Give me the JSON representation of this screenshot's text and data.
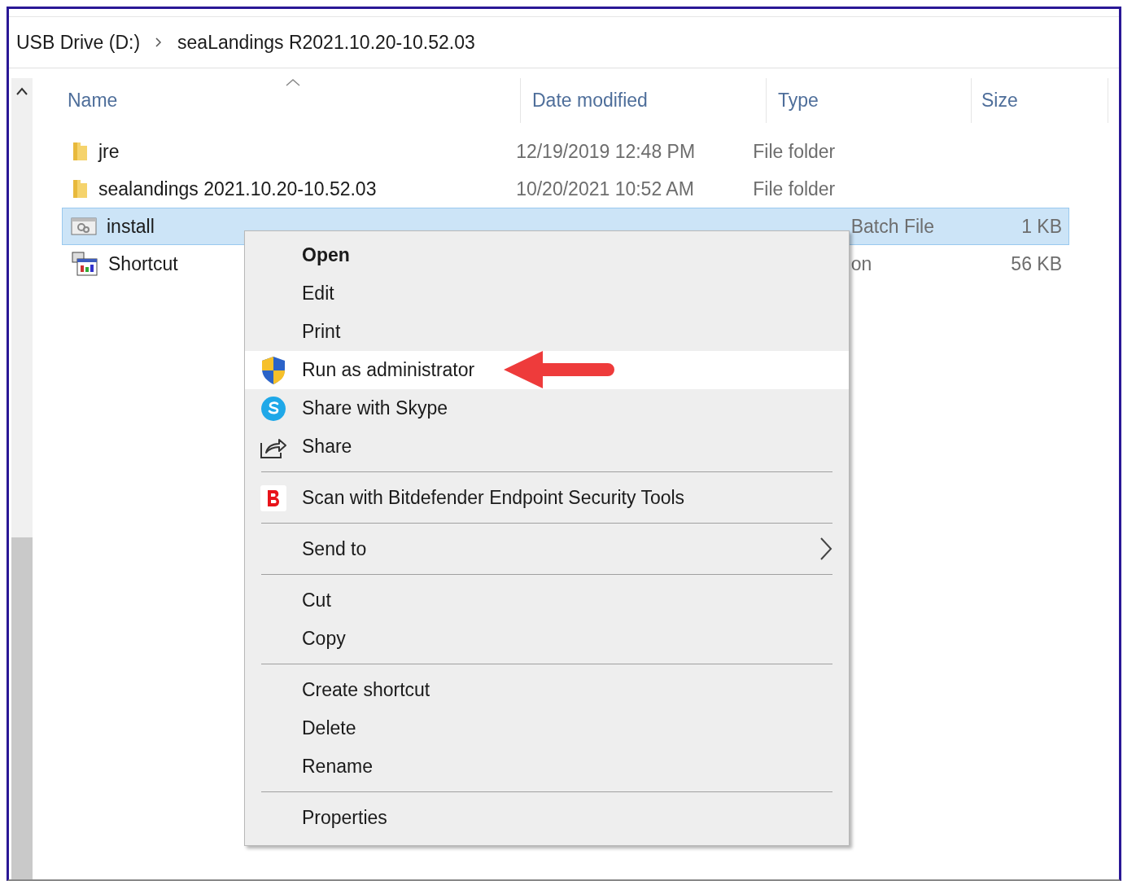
{
  "breadcrumb": [
    "USB Drive (D:)",
    "seaLandings R2021.10.20-10.52.03"
  ],
  "table": {
    "columns": [
      {
        "label": "Name",
        "sorted": true
      },
      {
        "label": "Date modified",
        "sorted": false
      },
      {
        "label": "Type",
        "sorted": false
      },
      {
        "label": "Size",
        "sorted": false
      }
    ],
    "rows": [
      {
        "kind": "folder",
        "name": "jre",
        "date": "12/19/2019 12:48 PM",
        "type": "File folder",
        "selected": false,
        "covered": false
      },
      {
        "kind": "folder",
        "name": "sealandings 2021.10.20-10.52.03",
        "date": "10/20/2021 10:52 AM",
        "type": "File folder",
        "selected": false,
        "covered": false
      },
      {
        "kind": "batch",
        "name": "install",
        "type": "Batch File",
        "size": "1 KB",
        "selected": true,
        "covered": true
      },
      {
        "kind": "app",
        "name": "Shortcut",
        "type": "on",
        "size": "56 KB",
        "selected": false,
        "covered": true
      }
    ]
  },
  "context_menu": {
    "items": [
      {
        "kind": "item",
        "label": "Open",
        "bold": true,
        "highlighted": false
      },
      {
        "kind": "item",
        "label": "Edit",
        "bold": false,
        "highlighted": false
      },
      {
        "kind": "item",
        "label": "Print",
        "bold": false,
        "highlighted": false
      },
      {
        "kind": "item",
        "label": "Run as administrator",
        "bold": false,
        "highlighted": true
      },
      {
        "kind": "item",
        "label": "Share with Skype",
        "bold": false,
        "highlighted": false
      },
      {
        "kind": "item",
        "label": "Share",
        "bold": false,
        "highlighted": false
      },
      {
        "kind": "separator"
      },
      {
        "kind": "item",
        "label": "Scan with Bitdefender Endpoint Security Tools",
        "bold": false,
        "highlighted": false
      },
      {
        "kind": "separator"
      },
      {
        "kind": "item",
        "label": "Send to",
        "submenu": true,
        "bold": false,
        "highlighted": false
      },
      {
        "kind": "separator"
      },
      {
        "kind": "item",
        "label": "Cut",
        "bold": false,
        "highlighted": false
      },
      {
        "kind": "item",
        "label": "Copy",
        "bold": false,
        "highlighted": false
      },
      {
        "kind": "separator"
      },
      {
        "kind": "item",
        "label": "Create shortcut",
        "bold": false,
        "highlighted": false
      },
      {
        "kind": "item",
        "label": "Delete",
        "bold": false,
        "highlighted": false
      },
      {
        "kind": "item",
        "label": "Rename",
        "bold": false,
        "highlighted": false
      },
      {
        "kind": "separator"
      },
      {
        "kind": "item",
        "label": "Properties",
        "bold": false,
        "highlighted": false
      }
    ]
  }
}
